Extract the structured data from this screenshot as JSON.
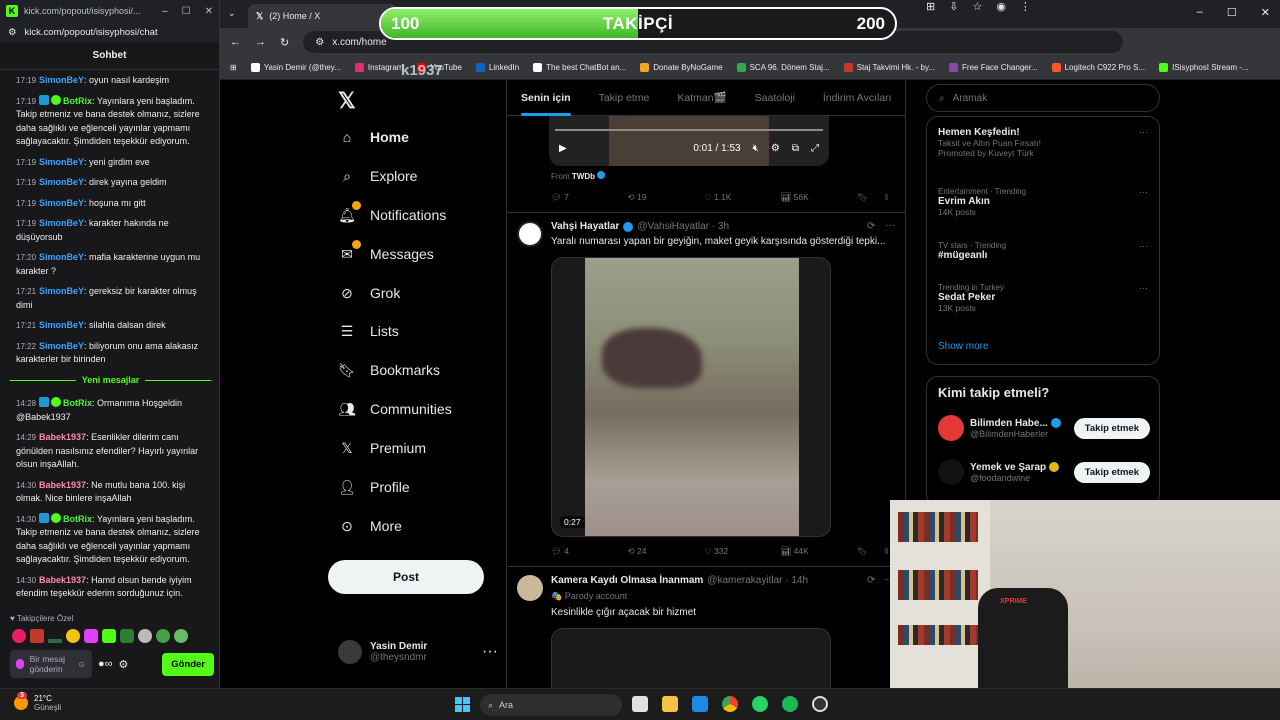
{
  "overlay": {
    "left_value": "100",
    "label": "TAKİPÇİ",
    "right_value": "200",
    "progress": 0.5,
    "username": "k1937"
  },
  "chat_window": {
    "title": "kick.com/popout/isisyphosi/...",
    "url": "kick.com/popout/isisyphosi/chat",
    "header": "Sohbet",
    "messages": [
      {
        "time": "17:19",
        "user": "SimonBeY",
        "text": ": oyun nasıl kardeşim"
      },
      {
        "time": "17:19",
        "user": "BotRix",
        "text": ": Yayınlara yeni başladım. Takip etmeniz ve bana destek olmanız, sizlere daha sağlıklı ve eğlenceli yayınlar yapmamı sağlayacaktır. Şimdiden teşekkür ediyorum."
      },
      {
        "time": "17:19",
        "user": "SimonBeY",
        "text": ": yeni girdim eve"
      },
      {
        "time": "17:19",
        "user": "SimonBeY",
        "text": ": direk yayına geldim"
      },
      {
        "time": "17:19",
        "user": "SimonBeY",
        "text": ": hoşuna mı gitt"
      },
      {
        "time": "17:19",
        "user": "SimonBeY",
        "text": ": karakter hakında ne düşüyorsub"
      },
      {
        "time": "17:20",
        "user": "SimonBeY",
        "text": ": mafia karakterine uygun mu karakter ?"
      },
      {
        "time": "17:21",
        "user": "SimonBeY",
        "text": ": gereksiz bir karakter olmuş dimi"
      },
      {
        "time": "17:21",
        "user": "SimonBeY",
        "text": ": silahla dalsan direk"
      },
      {
        "time": "17:22",
        "user": "SimonBeY",
        "text": ": biliyorum onu ama alakasız karakterler bir birinden"
      }
    ],
    "new_messages_label": "Yeni mesajlar",
    "new_messages": [
      {
        "time": "14:28",
        "user": "BotRix",
        "text": ": Ormanıma Hoşgeldin @Babek1937"
      },
      {
        "time": "14:29",
        "user": "Babek1937",
        "text": ": Esenlikler dilerim canı gönülden nasılsınız efendiler? Hayırlı yayınlar olsun inşaAllah."
      },
      {
        "time": "14:30",
        "user": "Babek1937",
        "text": ": Ne mutlu bana 100. kişi olmak. Nice binlere inşaAllah"
      },
      {
        "time": "14:30",
        "user": "BotRix",
        "text": ": Yayınlara yeni başladım. Takip etmeniz ve bana destek olmanız, sizlere daha sağlıklı ve eğlenceli yayınlar yapmamı sağlayacaktır. Şimdiden teşekkür ediyorum."
      },
      {
        "time": "14:30",
        "user": "Babek1937",
        "text": ": Hamd olsun bende iyiyim efendim teşekkür ederim sorduğunuz için."
      }
    ],
    "followers_label": "Takipçilere Özel",
    "input_placeholder": "Bir mesaj gönderin",
    "send_label": "Gönder"
  },
  "browser": {
    "tab_title": "(2) Home / X",
    "url": "x.com/home",
    "bookmarks": [
      {
        "label": "Yasin Demir (@they...",
        "color": "#ffffff"
      },
      {
        "label": "Instagram",
        "color": "#e1306c"
      },
      {
        "label": "YouTube",
        "color": "#ff0000"
      },
      {
        "label": "LinkedIn",
        "color": "#0a66c2"
      },
      {
        "label": "The best ChatBot an...",
        "color": "#ffffff"
      },
      {
        "label": "Donate ByNoGame",
        "color": "#f5a623"
      },
      {
        "label": "SCA 96. Dönem Staj...",
        "color": "#34a853"
      },
      {
        "label": "Staj Takvimi Hk. - by...",
        "color": "#c53929"
      },
      {
        "label": "Free Face Changer...",
        "color": "#8e44ad"
      },
      {
        "label": "Logitech C922 Pro S...",
        "color": "#ff5722"
      },
      {
        "label": "ISisyphosI Stream -...",
        "color": "#53fc18"
      }
    ]
  },
  "x": {
    "nav": [
      {
        "label": "Home",
        "icon": "home-icon"
      },
      {
        "label": "Explore",
        "icon": "search-icon"
      },
      {
        "label": "Notifications",
        "icon": "bell-icon"
      },
      {
        "label": "Messages",
        "icon": "mail-icon"
      },
      {
        "label": "Grok",
        "icon": "grok-icon"
      },
      {
        "label": "Lists",
        "icon": "list-icon"
      },
      {
        "label": "Bookmarks",
        "icon": "bookmark-icon"
      },
      {
        "label": "Communities",
        "icon": "communities-icon"
      },
      {
        "label": "Premium",
        "icon": "x-logo-icon"
      },
      {
        "label": "Profile",
        "icon": "person-icon"
      },
      {
        "label": "More",
        "icon": "more-circle-icon"
      }
    ],
    "post_label": "Post",
    "me": {
      "name": "Yasin Demir",
      "handle": "@theysndmr"
    },
    "tabs": [
      "Senin için",
      "Takip etme",
      "Katman🎬",
      "Saatoloji",
      "İndirim Avcıları"
    ],
    "video1": {
      "time": "0:01 / 1:53",
      "from_label": "From",
      "from_name": "TWDb"
    },
    "tweet1_actions": [
      "7",
      "19",
      "1.1K",
      "56K"
    ],
    "tweet2": {
      "name": "Vahşi Hayatlar",
      "handle": "@VahsiHayatlar · 3h",
      "text": "Yaralı numarası yapan bir geyiğin, maket geyik karşısında gösterdiği tepki...",
      "duration": "0:27",
      "actions": [
        "4",
        "24",
        "332",
        "44K"
      ]
    },
    "tweet3": {
      "name": "Kamera Kaydı Olmasa İnanmam",
      "handle": "@kamerakayitlar · 14h",
      "label": "Parody account",
      "text": "Kesinlikle çığır açacak bir hizmet"
    },
    "search_placeholder": "Aramak",
    "trends": [
      {
        "category": "",
        "name": "Hemen Keşfedin!",
        "sub": "Taksit ve Altın Puan Fırsatı!",
        "sub2": "Promoted by Kuveyt Türk"
      },
      {
        "category": "Entertainment · Trending",
        "name": "Evrim Akın",
        "sub": "14K posts",
        "sub2": ""
      },
      {
        "category": "TV stars · Trending",
        "name": "#mügeanlı",
        "sub": "",
        "sub2": ""
      },
      {
        "category": "Trending in Turkey",
        "name": "Sedat Peker",
        "sub": "13K posts",
        "sub2": ""
      }
    ],
    "show_more": "Show more",
    "who_title": "Kimi takip etmeli?",
    "accounts": [
      {
        "name": "Bilimden Habe...",
        "handle": "@BilimdenHaberler",
        "follow": "Takip etmek",
        "color": "#e53935"
      },
      {
        "name": "Yemek ve Şarap",
        "handle": "@foodandwine",
        "follow": "Takip etmek",
        "color": "#111111"
      }
    ]
  },
  "taskbar": {
    "temp": "21°C",
    "weather": "Güneşli",
    "badge": "3",
    "search_placeholder": "Ara"
  }
}
